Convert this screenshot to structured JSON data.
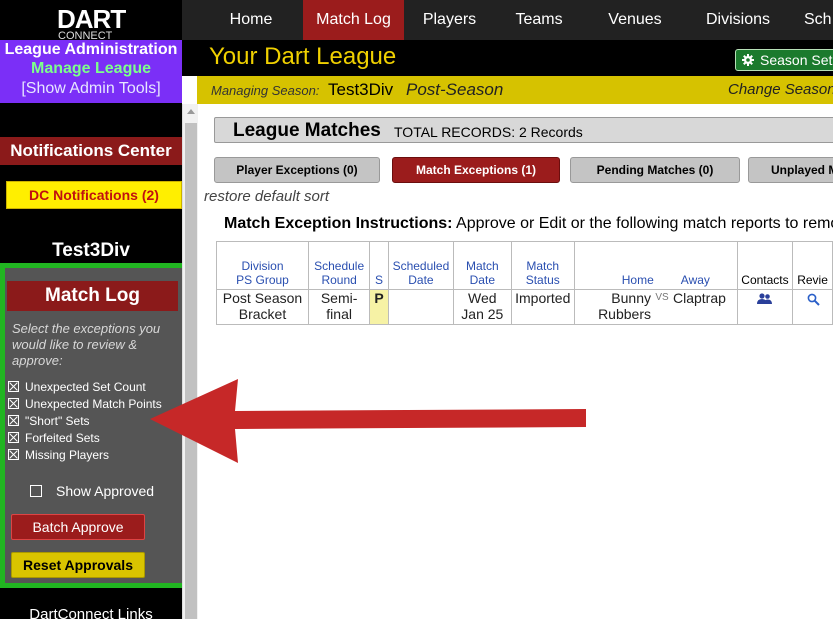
{
  "logo": {
    "main": "DART",
    "sub": "CONNECT"
  },
  "topnav": {
    "items": [
      "Home",
      "Match Log",
      "Players",
      "Teams",
      "Venues",
      "Divisions",
      "Sch"
    ],
    "active": "Match Log"
  },
  "admin": {
    "title": "League Administration",
    "manage": "Manage League",
    "tools": "[Show Admin Tools]"
  },
  "notifications": {
    "header": "Notifications Center",
    "button": "DC Notifications (2)"
  },
  "sidebar": {
    "season_name": "Test3Div",
    "dc_links": "DartConnect Links"
  },
  "match_log_panel": {
    "header": "Match Log",
    "instructions": "Select the exceptions you would like to review & approve:",
    "checks": [
      {
        "label": "Unexpected Set Count",
        "checked": true
      },
      {
        "label": "Unexpected Match Points",
        "checked": true
      },
      {
        "label": "\"Short\" Sets",
        "checked": true
      },
      {
        "label": "Forfeited Sets",
        "checked": true
      },
      {
        "label": "Missing Players",
        "checked": true
      }
    ],
    "show_approved": {
      "label": "Show Approved",
      "checked": false
    },
    "batch_approve": "Batch Approve",
    "reset_approvals": "Reset Approvals"
  },
  "header": {
    "league_title": "Your Dart League",
    "season_settings": "Season Set",
    "managing_label": "Managing Season:",
    "season": "Test3Div",
    "season_status": "Post-Season",
    "change_season": "Change Season"
  },
  "main": {
    "title": "League Matches",
    "records": "TOTAL RECORDS: 2 Records",
    "tabs": [
      {
        "label": "Player Exceptions (0)",
        "active": false
      },
      {
        "label": "Match Exceptions (1)",
        "active": true
      },
      {
        "label": "Pending Matches (0)",
        "active": false
      },
      {
        "label": "Unplayed M",
        "active": false
      }
    ],
    "restore_sort": "restore default sort",
    "instructions_bold": "Match Exception Instructions:",
    "instructions_text": "Approve or Edit or the following match reports to remo"
  },
  "table": {
    "headers": {
      "division": [
        "Division",
        "PS Group"
      ],
      "round": [
        "Schedule",
        "Round"
      ],
      "s": "S",
      "sched_date": [
        "Scheduled",
        "Date"
      ],
      "match_date": [
        "Match",
        "Date"
      ],
      "match_status": [
        "Match",
        "Status"
      ],
      "home": "Home",
      "away": "Away",
      "contacts": "Contacts",
      "review": "Revie"
    },
    "rows": [
      {
        "division": [
          "Post Season",
          "Bracket"
        ],
        "round": [
          "Semi-",
          "final"
        ],
        "s": "P",
        "sched_date": "",
        "match_date": [
          "Wed",
          "Jan 25"
        ],
        "match_status": "Imported",
        "home": [
          "Bunny",
          "Rubbers"
        ],
        "vs": "VS",
        "away": "Claptrap",
        "contacts_icon": "people-icon",
        "review_icon": "magnifier-icon"
      }
    ]
  },
  "colors": {
    "nav_bg": "#222222",
    "active_red": "#9b1c1c",
    "admin_purple": "#7b2ff7",
    "highlight_green": "#21b521",
    "league_yellow": "#d6c200",
    "arrow_red": "#c62828"
  }
}
